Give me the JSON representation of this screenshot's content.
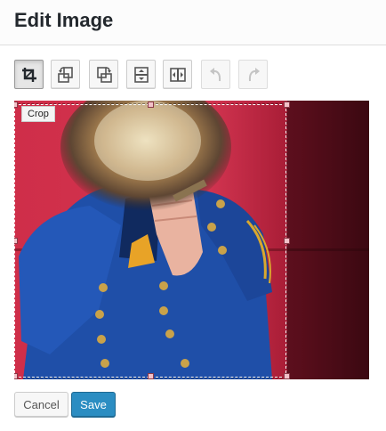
{
  "dialog": {
    "title": "Edit Image"
  },
  "toolbar": {
    "tools": [
      {
        "name": "crop",
        "icon": "crop-icon",
        "state": "active"
      },
      {
        "name": "rotate-left",
        "icon": "rotate-left-icon",
        "state": "enabled"
      },
      {
        "name": "rotate-right",
        "icon": "rotate-right-icon",
        "state": "enabled"
      },
      {
        "name": "flip-vertical",
        "icon": "flip-vertical-icon",
        "state": "enabled"
      },
      {
        "name": "flip-horizontal",
        "icon": "flip-horizontal-icon",
        "state": "enabled"
      },
      {
        "name": "undo",
        "icon": "undo-icon",
        "state": "disabled"
      },
      {
        "name": "redo",
        "icon": "redo-icon",
        "state": "disabled"
      }
    ]
  },
  "crop": {
    "label": "Crop"
  },
  "actions": {
    "cancel_label": "Cancel",
    "save_label": "Save"
  },
  "colors": {
    "accent": "#2b8dc2",
    "photo_background": "#d23450",
    "jacket": "#1f4fa8"
  }
}
